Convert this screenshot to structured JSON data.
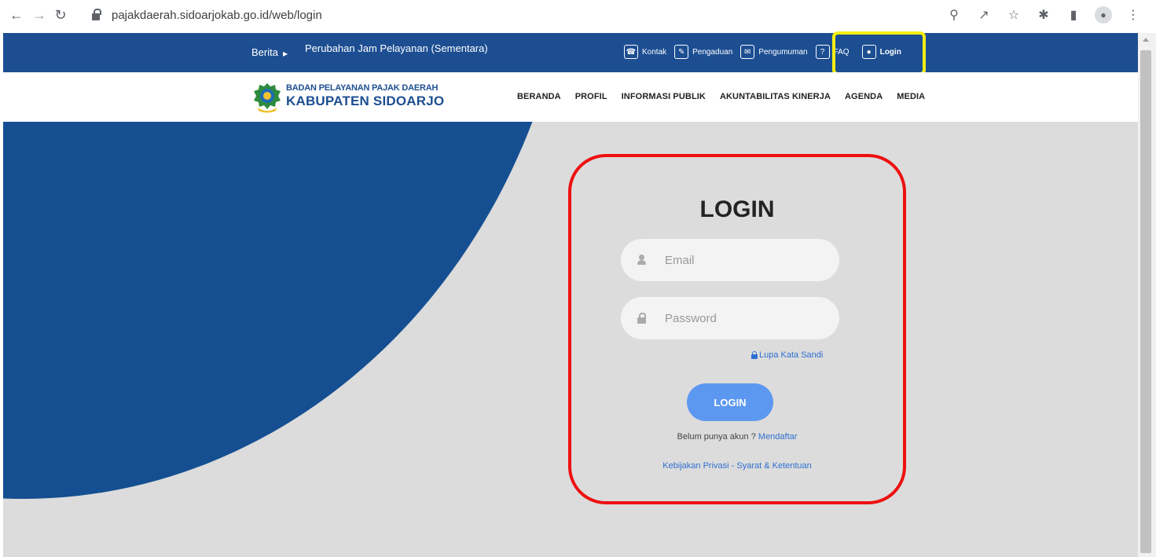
{
  "browser": {
    "url": "pajakdaerah.sidoarjokab.go.id/web/login"
  },
  "topbar": {
    "news_label": "Berita",
    "news_headline": "Perubahan Jam Pelayanan (Sementara)",
    "menu": {
      "kontak": "Kontak",
      "pengaduan": "Pengaduan",
      "pengumuman": "Pengumuman",
      "faq": "FAQ",
      "login": "Login"
    }
  },
  "header": {
    "logo_line1": "BADAN PELAYANAN PAJAK DAERAH",
    "logo_line2": "KABUPATEN SIDOARJO",
    "nav": [
      "BERANDA",
      "PROFIL",
      "INFORMASI PUBLIK",
      "AKUNTABILITAS KINERJA",
      "AGENDA",
      "MEDIA"
    ]
  },
  "login": {
    "title": "LOGIN",
    "email_placeholder": "Email",
    "password_placeholder": "Password",
    "forgot": "Lupa Kata Sandi",
    "submit": "LOGIN",
    "no_account": "Belum punya akun ?",
    "register": "Mendaftar",
    "privacy": "Kebijakan Privasi - Syarat & Ketentuan"
  },
  "colors": {
    "brand_blue": "#1d4e92",
    "button_blue": "#5d98f0",
    "highlight_yellow": "#f6ee13",
    "highlight_red": "#ee1010"
  }
}
